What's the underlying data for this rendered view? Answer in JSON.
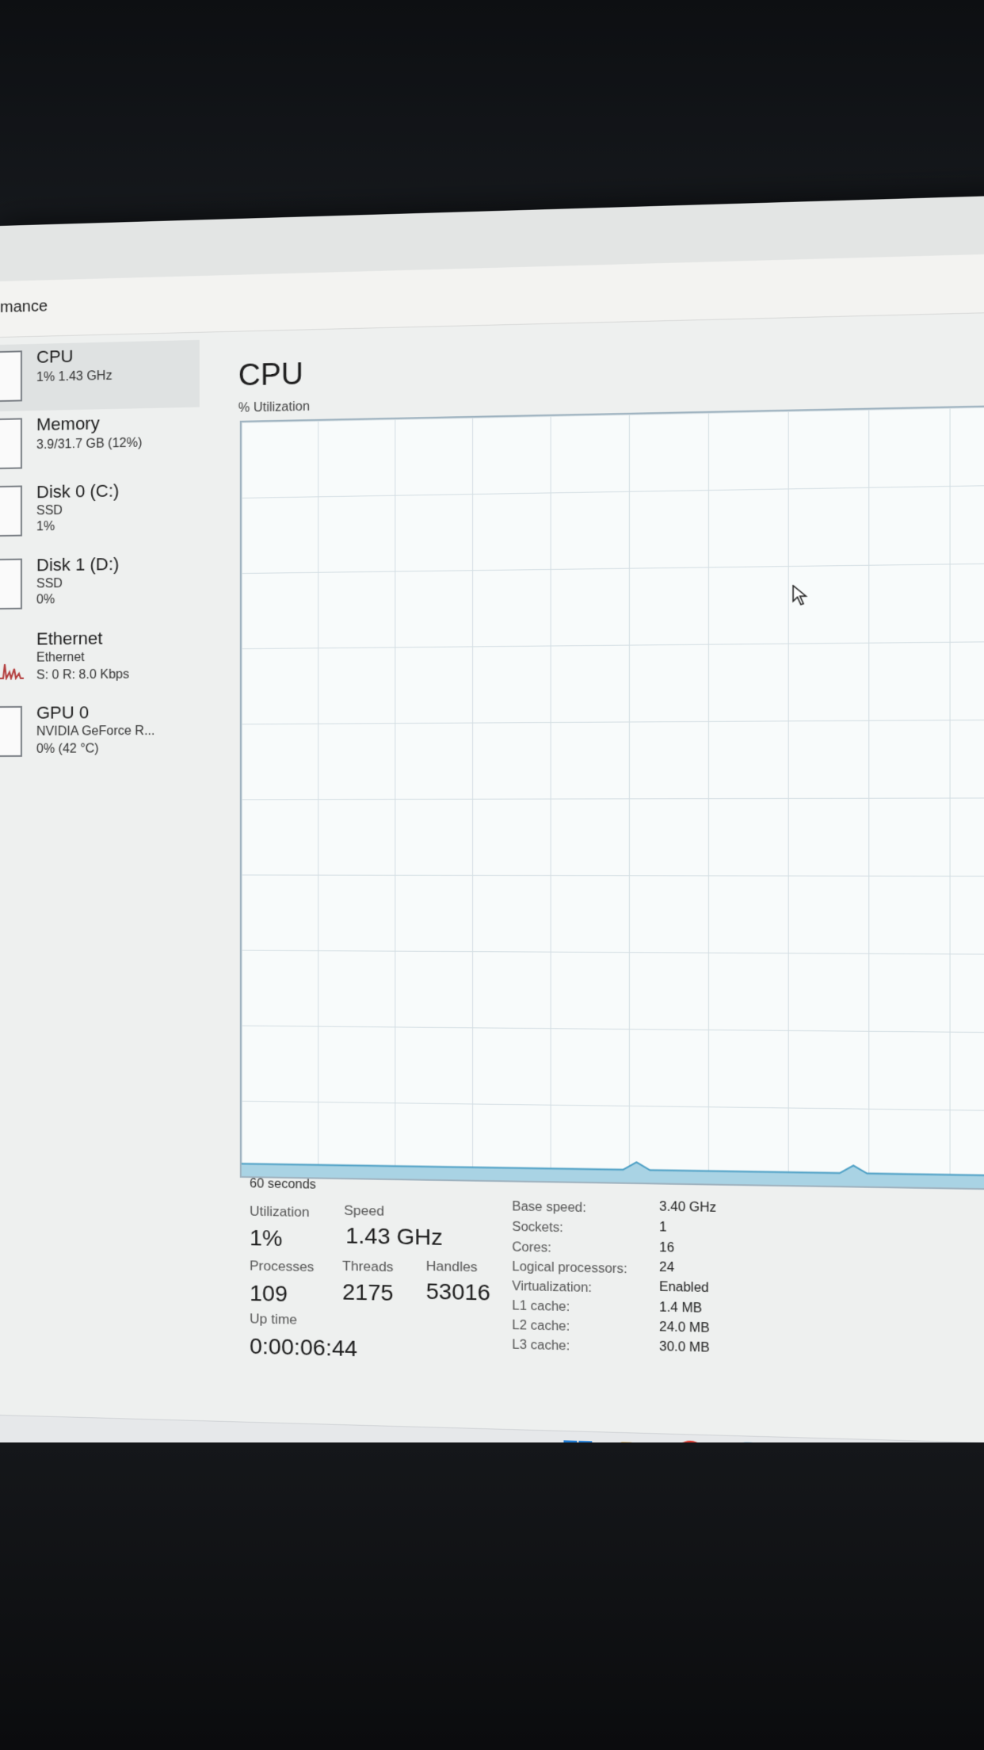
{
  "header": {
    "title": "mance"
  },
  "sidebar": {
    "items": [
      {
        "name": "CPU",
        "line1": "1% 1.43 GHz",
        "line2": ""
      },
      {
        "name": "Memory",
        "line1": "3.9/31.7 GB (12%)",
        "line2": ""
      },
      {
        "name": "Disk 0 (C:)",
        "line1": "SSD",
        "line2": "1%"
      },
      {
        "name": "Disk 1 (D:)",
        "line1": "SSD",
        "line2": "0%"
      },
      {
        "name": "Ethernet",
        "line1": "Ethernet",
        "line2": "S: 0 R: 8.0 Kbps"
      },
      {
        "name": "GPU 0",
        "line1": "NVIDIA GeForce R...",
        "line2": "0% (42 °C)"
      }
    ]
  },
  "main": {
    "title": "CPU",
    "util_label": "% Utilization",
    "time_label": "60 seconds",
    "stats": {
      "utilization_label": "Utilization",
      "utilization": "1%",
      "speed_label": "Speed",
      "speed": "1.43 GHz",
      "processes_label": "Processes",
      "processes": "109",
      "threads_label": "Threads",
      "threads": "2175",
      "handles_label": "Handles",
      "handles": "53016",
      "uptime_label": "Up time",
      "uptime": "0:00:06:44"
    },
    "details": [
      {
        "label": "Base speed:",
        "value": "3.40 GHz"
      },
      {
        "label": "Sockets:",
        "value": "1"
      },
      {
        "label": "Cores:",
        "value": "16"
      },
      {
        "label": "Logical processors:",
        "value": "24"
      },
      {
        "label": "Virtualization:",
        "value": "Enabled"
      },
      {
        "label": "L1 cache:",
        "value": "1.4 MB"
      },
      {
        "label": "L2 cache:",
        "value": "24.0 MB"
      },
      {
        "label": "L3 cache:",
        "value": "30.0 MB"
      }
    ],
    "utilization_history": [
      1,
      1,
      1,
      1,
      1,
      1,
      1,
      1,
      1,
      1,
      1,
      1,
      1,
      1,
      1,
      1,
      1,
      1,
      1,
      1,
      1,
      1,
      1,
      1,
      1,
      1,
      1,
      1,
      1,
      1,
      2,
      1,
      1,
      1,
      1,
      1,
      1,
      1,
      1,
      1,
      1,
      1,
      1,
      1,
      1,
      1,
      2,
      1,
      1,
      1,
      1,
      1,
      1,
      1,
      1,
      1,
      1,
      1,
      1,
      1
    ]
  },
  "taskbar": {
    "icons": [
      "windows-start-icon",
      "file-explorer-icon",
      "chrome-icon",
      "edge-icon",
      "store-icon",
      "task-manager-icon"
    ]
  }
}
